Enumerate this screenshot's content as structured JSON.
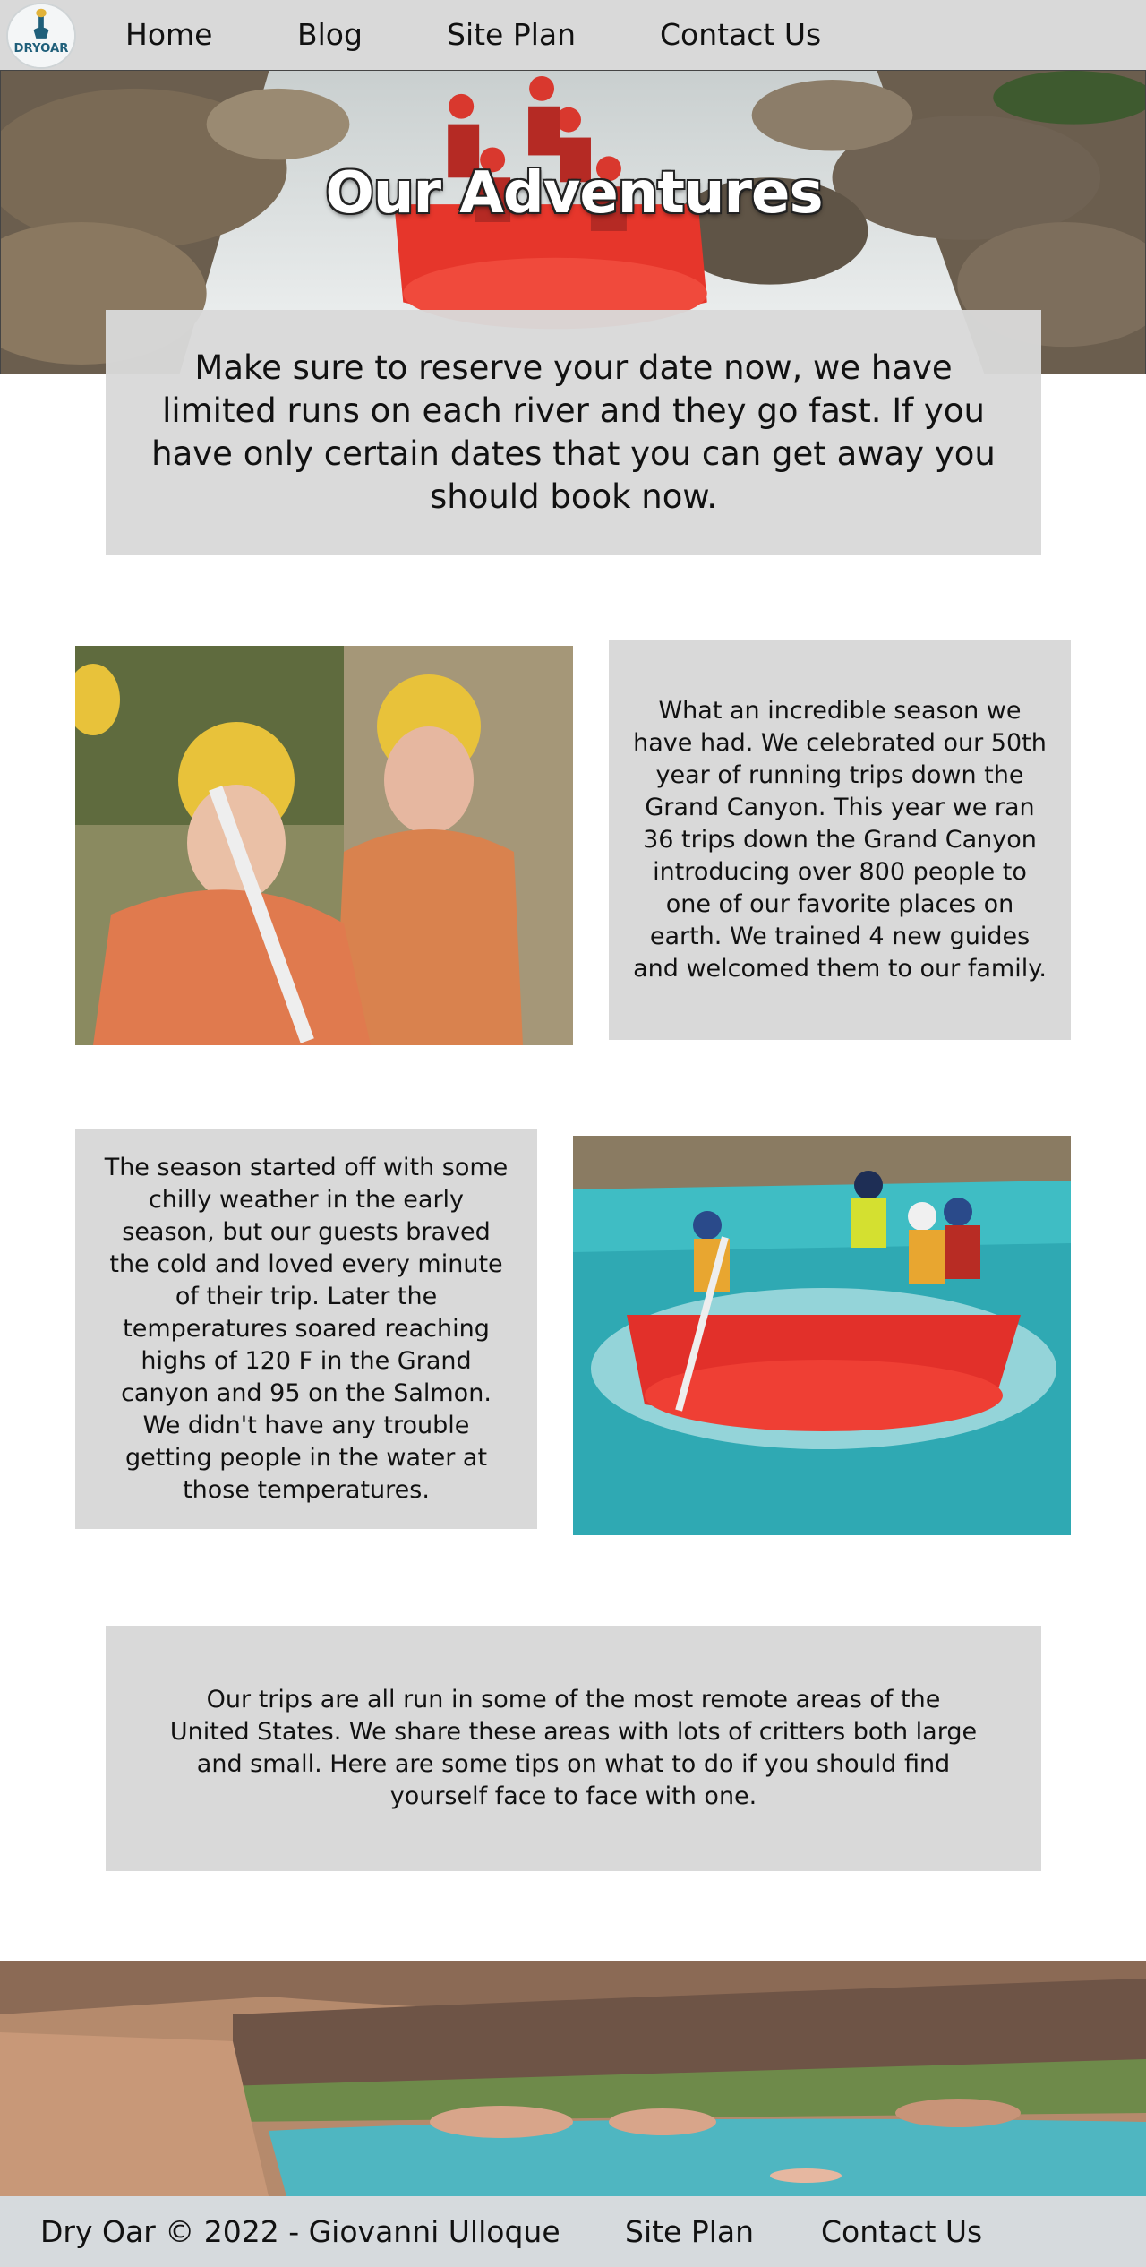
{
  "nav": {
    "logo_text": "DRYOAR",
    "items": [
      {
        "label": "Home"
      },
      {
        "label": "Blog"
      },
      {
        "label": "Site Plan"
      },
      {
        "label": "Contact Us"
      }
    ]
  },
  "hero": {
    "title": "Our Adventures",
    "notice": "Make sure to reserve your date now, we have limited runs on each river and they go fast. If you have only certain dates that you can get away you should book now."
  },
  "sections": [
    {
      "text": "What an incredible season we have had. We celebrated our 50th year of running trips down the Grand Canyon. This year we ran 36 trips down the Grand Canyon introducing over 800 people to one of our favorite places on earth. We trained 4 new guides and welcomed them to our family."
    },
    {
      "text": "The season started off with some chilly weather in the early season, but our guests braved the cold and loved every minute of their trip. Later the temperatures soared reaching highs of 120 F in the Grand canyon and 95 on the Salmon. We didn't have any trouble getting people in the water at those temperatures."
    },
    {
      "text": "Our trips are all run in some of the most remote areas of the United States. We share these areas with lots of critters both large and small. Here are some tips on what to do if you should find yourself face to face with one."
    }
  ],
  "footer": {
    "copyright": "Dry Oar © 2022 - Giovanni Ulloque",
    "links": [
      {
        "label": "Site Plan"
      },
      {
        "label": "Contact Us"
      }
    ]
  }
}
